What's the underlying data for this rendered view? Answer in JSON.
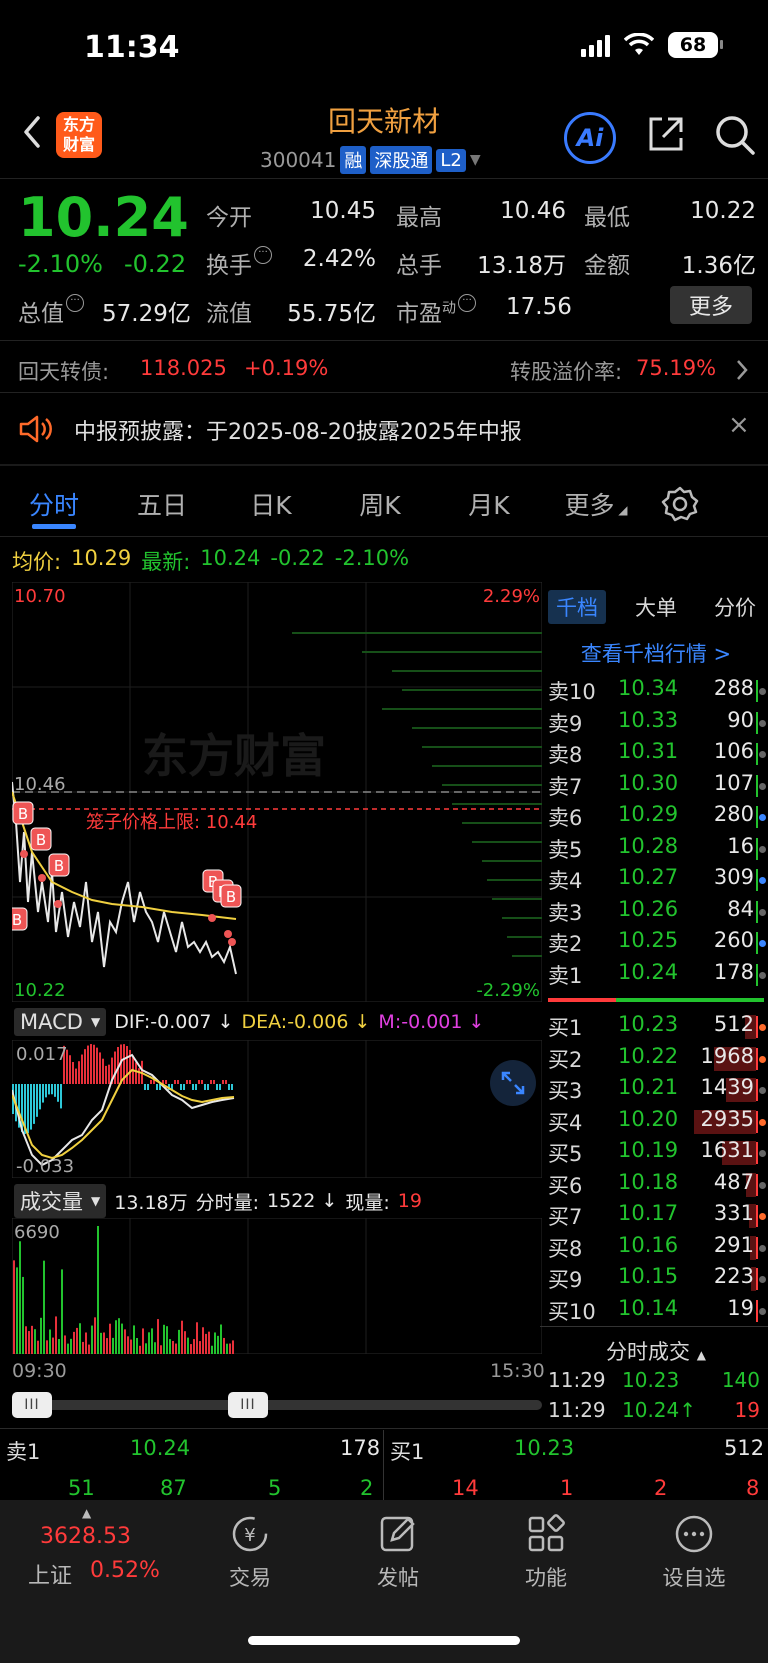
{
  "status": {
    "time": "11:34",
    "battery": "68"
  },
  "header": {
    "logo_line1": "东方",
    "logo_line2": "财富",
    "stock_name": "回天新材",
    "stock_code": "300041",
    "tags": [
      "融",
      "深股通",
      "L2"
    ]
  },
  "quote": {
    "price": "10.24",
    "pct_change": "-2.10%",
    "abs_change": "-0.22",
    "fields": [
      {
        "label": "今开",
        "value": "10.45",
        "color": "green"
      },
      {
        "label": "最高",
        "value": "10.46",
        "color": "white"
      },
      {
        "label": "最低",
        "value": "10.22",
        "color": "green"
      },
      {
        "label": "换手",
        "value": "2.42%",
        "color": "white"
      },
      {
        "label": "总手",
        "value": "13.18万",
        "color": "white"
      },
      {
        "label": "金额",
        "value": "1.36亿",
        "color": "white"
      },
      {
        "label": "总值",
        "value": "57.29亿",
        "color": "white"
      },
      {
        "label": "流值",
        "value": "55.75亿",
        "color": "white"
      },
      {
        "label": "市盈",
        "label_sup": "动",
        "value": "17.56",
        "color": "white"
      }
    ],
    "more_label": "更多"
  },
  "bond": {
    "label": "回天转债:",
    "price": "118.025",
    "pct": "+0.19%",
    "premium_label": "转股溢价率:",
    "premium_value": "75.19%"
  },
  "notice": {
    "text": "中报预披露：于2025-08-20披露2025年中报"
  },
  "tabs": [
    "分时",
    "五日",
    "日K",
    "周K",
    "月K",
    "更多"
  ],
  "avg_line": {
    "avg_label": "均价:",
    "avg_value": "10.29",
    "latest_label": "最新:",
    "latest_value": "10.24",
    "change": "-0.22",
    "pct": "-2.10%"
  },
  "main_chart": {
    "y_top": "10.70",
    "y_mid": "10.46",
    "y_bottom": "10.22",
    "pct_top": "2.29%",
    "pct_bottom": "-2.29%",
    "limit_label": "笼子价格上限: 10.44",
    "watermark": "东方财富",
    "b_marker": "B"
  },
  "macd": {
    "selector": "MACD",
    "dif": "DIF:-0.007 ↓",
    "dea": "DEA:-0.006 ↓",
    "m": "M:-0.001 ↓",
    "y_top": "0.017",
    "y_bottom": "-0.033"
  },
  "volume": {
    "selector": "成交量",
    "total": "13.18万",
    "minute_label": "分时量:",
    "minute_value": "1522 ↓",
    "now_label": "现量:",
    "now_value": "19",
    "y_top": "6690"
  },
  "time_axis": {
    "start": "09:30",
    "end": "15:30"
  },
  "book": {
    "tabs": [
      "千档",
      "大单",
      "分价"
    ],
    "link": "查看千档行情 >",
    "asks": [
      {
        "label": "卖10",
        "price": "10.34",
        "vol": "288"
      },
      {
        "label": "卖9",
        "price": "10.33",
        "vol": "90"
      },
      {
        "label": "卖8",
        "price": "10.31",
        "vol": "106"
      },
      {
        "label": "卖7",
        "price": "10.30",
        "vol": "107"
      },
      {
        "label": "卖6",
        "price": "10.29",
        "vol": "280"
      },
      {
        "label": "卖5",
        "price": "10.28",
        "vol": "16"
      },
      {
        "label": "卖4",
        "price": "10.27",
        "vol": "309"
      },
      {
        "label": "卖3",
        "price": "10.26",
        "vol": "84"
      },
      {
        "label": "卖2",
        "price": "10.25",
        "vol": "260"
      },
      {
        "label": "卖1",
        "price": "10.24",
        "vol": "178"
      }
    ],
    "bids": [
      {
        "label": "买1",
        "price": "10.23",
        "vol": "512"
      },
      {
        "label": "买2",
        "price": "10.22",
        "vol": "1968"
      },
      {
        "label": "买3",
        "price": "10.21",
        "vol": "1439"
      },
      {
        "label": "买4",
        "price": "10.20",
        "vol": "2935"
      },
      {
        "label": "买5",
        "price": "10.19",
        "vol": "1631"
      },
      {
        "label": "买6",
        "price": "10.18",
        "vol": "487"
      },
      {
        "label": "买7",
        "price": "10.17",
        "vol": "331"
      },
      {
        "label": "买8",
        "price": "10.16",
        "vol": "291"
      },
      {
        "label": "买9",
        "price": "10.15",
        "vol": "223"
      },
      {
        "label": "买10",
        "price": "10.14",
        "vol": "19"
      }
    ],
    "trades_title": "分时成交",
    "trades": [
      {
        "time": "11:29",
        "price": "10.23",
        "vol": "140"
      },
      {
        "time": "11:29",
        "price": "10.24↑",
        "vol": "19"
      }
    ]
  },
  "strip": {
    "ask_label": "卖1",
    "ask_price": "10.24",
    "ask_vol": "178",
    "bid_label": "买1",
    "bid_price": "10.23",
    "bid_vol": "512",
    "ask_queue": [
      "51",
      "87",
      "5",
      "2"
    ],
    "bid_queue": [
      "14",
      "1",
      "2",
      "8"
    ]
  },
  "nav": {
    "index_value": "3628.53",
    "index_name": "上证",
    "index_pct": "0.52%",
    "items": [
      "交易",
      "发帖",
      "功能",
      "设自选"
    ]
  },
  "colors": {
    "up": "#ff3b3b",
    "down": "#22c32e",
    "accent": "#3a86ff",
    "brand": "#ff5a1a",
    "avg_line": "#f0d040"
  }
}
